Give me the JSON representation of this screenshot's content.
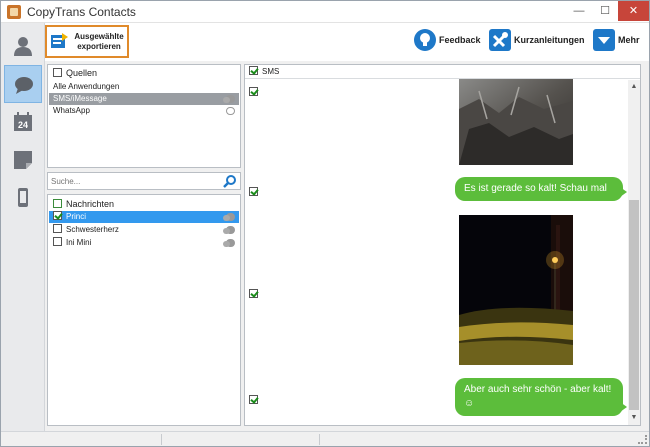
{
  "window": {
    "title": "CopyTrans Contacts",
    "minimize": "—",
    "maximize": "☐",
    "close": "✕"
  },
  "nav": [
    {
      "name": "contacts-icon",
      "active": false
    },
    {
      "name": "messages-icon",
      "active": true
    },
    {
      "name": "calendar-icon",
      "active": false,
      "label": "24"
    },
    {
      "name": "notes-icon",
      "active": false
    },
    {
      "name": "device-icon",
      "active": false
    }
  ],
  "toolbar": {
    "export_label": "Ausgewählte exportieren",
    "feedback_label": "Feedback",
    "guides_label": "Kurzanleitungen",
    "more_label": "Mehr"
  },
  "sources": {
    "header": "Quellen",
    "items": [
      {
        "label": "Alle Anwendungen",
        "icon": ""
      },
      {
        "label": "SMS/iMessage",
        "icon": "chat-bubbles-icon"
      },
      {
        "label": "WhatsApp",
        "icon": "whatsapp-icon"
      }
    ]
  },
  "search": {
    "placeholder": "Suche..."
  },
  "contacts": {
    "header": "Nachrichten",
    "items": [
      {
        "label": "Princi",
        "checked": true,
        "selected": true
      },
      {
        "label": "Schwesterherz",
        "checked": false,
        "selected": false
      },
      {
        "label": "Ini Mini",
        "checked": false,
        "selected": false
      }
    ]
  },
  "conversation": {
    "header": "SMS",
    "messages": [
      {
        "type": "image",
        "description": "night-rock-photo"
      },
      {
        "type": "text",
        "text": "Es ist gerade so kalt! Schau mal"
      },
      {
        "type": "image",
        "description": "night-street-lamp-photo"
      },
      {
        "type": "text",
        "text": "Aber auch sehr schön - aber kalt! ☺"
      }
    ]
  },
  "colors": {
    "accent": "#1e78c8",
    "bubble": "#5cbd3b",
    "highlight": "#e08a2a",
    "selection": "#3399ee"
  }
}
